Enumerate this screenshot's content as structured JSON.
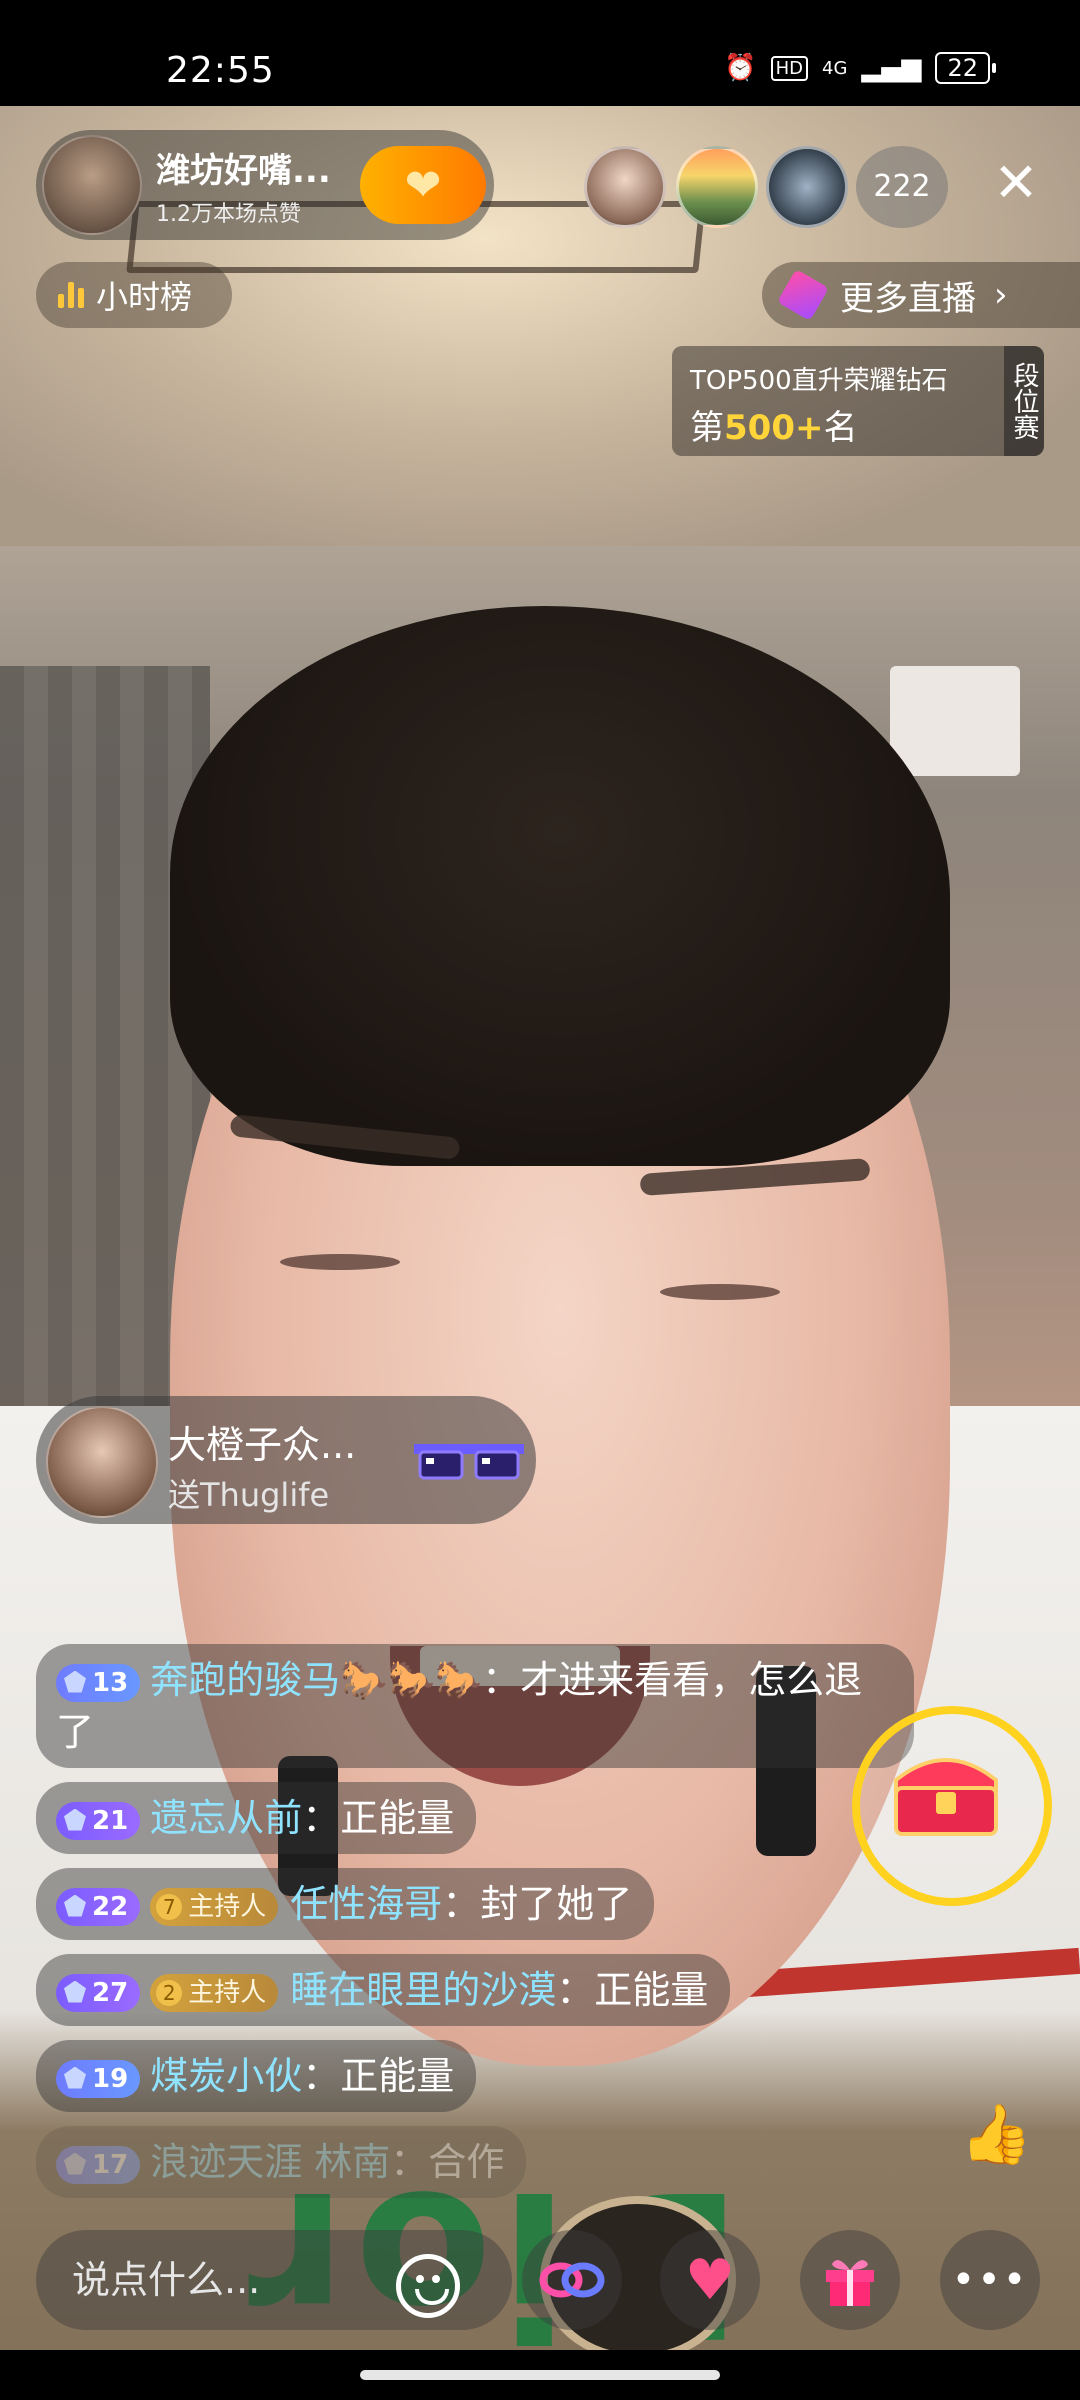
{
  "status_bar": {
    "time": "22:55",
    "hd": "HD",
    "network": "4G",
    "battery": "22"
  },
  "host": {
    "name": "潍坊好嘴...",
    "likes": "1.2万本场点赞"
  },
  "viewers": {
    "count": "222"
  },
  "rank_button": {
    "label": "小时榜"
  },
  "more_live": {
    "label": "更多直播"
  },
  "pk_card": {
    "line1": "TOP500直升荣耀钻石",
    "prefix": "第",
    "rank": "500+",
    "suffix": "名",
    "side": "段位赛"
  },
  "gift": {
    "sender": "大橙子众...",
    "text": "送Thuglife"
  },
  "comments": [
    {
      "level": "13",
      "user": "奔跑的骏马🐎🐎🐎",
      "text": "：才进来看看，怎么退了"
    },
    {
      "level": "21",
      "user": "遗忘从前",
      "text": "：正能量"
    },
    {
      "level": "22",
      "host_level": "7",
      "host_tag": "主持人",
      "user": "任性海哥",
      "text": "：封了她了"
    },
    {
      "level": "27",
      "host_level": "2",
      "host_tag": "主持人",
      "user": "睡在眼里的沙漠",
      "text": "：正能量"
    },
    {
      "level": "19",
      "user": "煤炭小伙",
      "text": "：正能量"
    },
    {
      "level": "17",
      "user": "浪迹天涯 林南",
      "text": "：合作"
    }
  ],
  "bottom_bar": {
    "placeholder": "说点什么..."
  },
  "colors": {
    "accent_orange": "#ff8a00",
    "username_blue": "#8fe3ff",
    "gold": "#ffd21f"
  }
}
